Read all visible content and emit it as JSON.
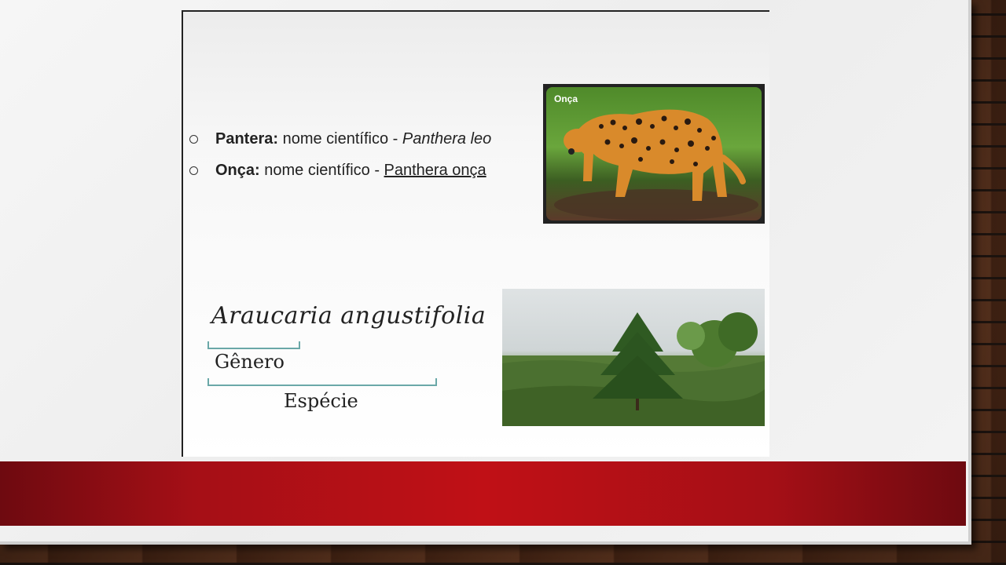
{
  "bullets": [
    {
      "bold": "Pantera:",
      "middle": " nome científico - ",
      "name": "Panthera leo",
      "name_style": "italic"
    },
    {
      "bold": "Onça:",
      "middle": " nome científico - ",
      "name": "Panthera onça",
      "name_style": "underline"
    }
  ],
  "jaguar_photo": {
    "label": "Onça"
  },
  "taxonomy": {
    "species_name": "Araucaria angustifolia",
    "genus_label": "Gênero",
    "species_label": "Espécie"
  },
  "colors": {
    "red_band": "#c01016",
    "bracket": "#6aa8a8"
  }
}
